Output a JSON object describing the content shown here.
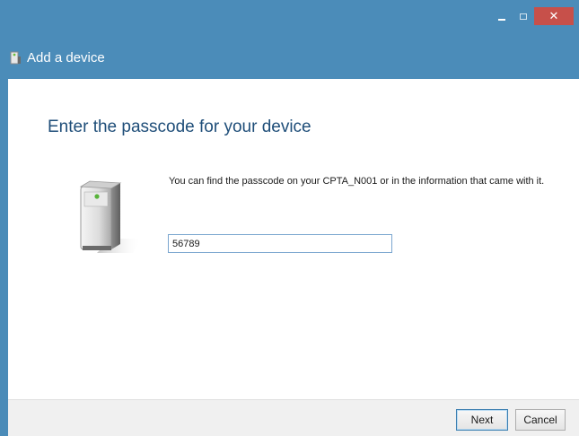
{
  "window": {
    "title": "Add a device",
    "controls": {
      "minimize": "minimize",
      "maximize": "maximize",
      "close_glyph": "✕"
    },
    "accent": "#4b8cb9",
    "close_color": "#c7504a"
  },
  "main": {
    "heading": "Enter the passcode for your device",
    "info": "You can find the passcode on your CPTA_N001 or in the information that came with it.",
    "passcode_value": "56789",
    "device_icon": "printer-device-icon"
  },
  "footer": {
    "next_label": "Next",
    "cancel_label": "Cancel"
  }
}
